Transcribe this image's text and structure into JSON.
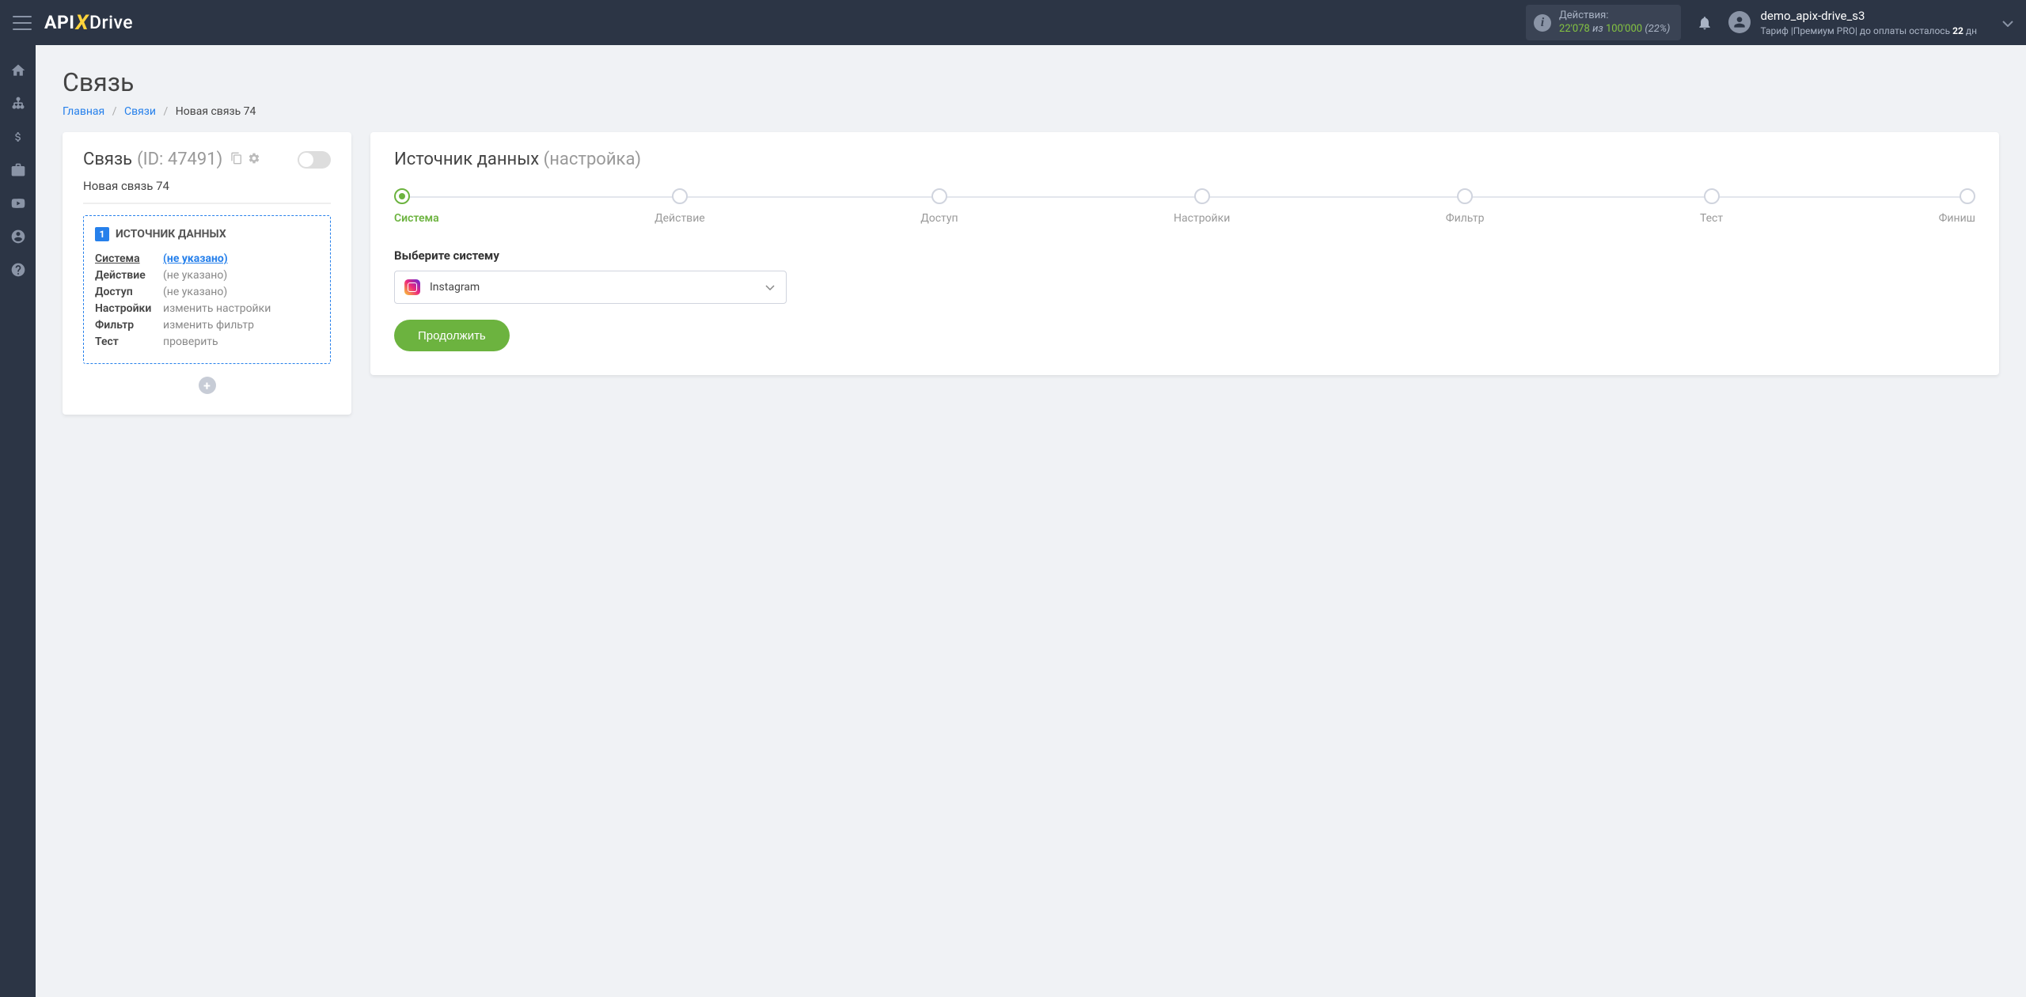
{
  "header": {
    "actions_label": "Действия:",
    "actions_num1": "22'078",
    "actions_iz": "из",
    "actions_num2": "100'000",
    "actions_pct": "(22%)",
    "user_name": "demo_apix-drive_s3",
    "tariff_text_pre": "Тариф |Премиум PRO| до оплаты осталось ",
    "tariff_bold": "22",
    "tariff_text_post": " дн"
  },
  "page": {
    "title": "Связь",
    "breadcrumb": {
      "home": "Главная",
      "links": "Связи",
      "current": "Новая связь 74"
    }
  },
  "left": {
    "title": "Связь",
    "id": "(ID: 47491)",
    "name": "Новая связь 74",
    "source_header": "ИСТОЧНИК ДАННЫХ",
    "badge": "1",
    "rows": [
      {
        "k": "Система",
        "v": "(не указано)",
        "link": true
      },
      {
        "k": "Действие",
        "v": "(не указано)",
        "link": false
      },
      {
        "k": "Доступ",
        "v": "(не указано)",
        "link": false
      },
      {
        "k": "Настройки",
        "v": "изменить настройки",
        "link": false
      },
      {
        "k": "Фильтр",
        "v": "изменить фильтр",
        "link": false
      },
      {
        "k": "Тест",
        "v": "проверить",
        "link": false
      }
    ]
  },
  "right": {
    "title": "Источник данных",
    "subtitle": "(настройка)",
    "steps": [
      "Система",
      "Действие",
      "Доступ",
      "Настройки",
      "Фильтр",
      "Тест",
      "Финиш"
    ],
    "form_label": "Выберите систему",
    "selected_system": "Instagram",
    "btn": "Продолжить"
  }
}
